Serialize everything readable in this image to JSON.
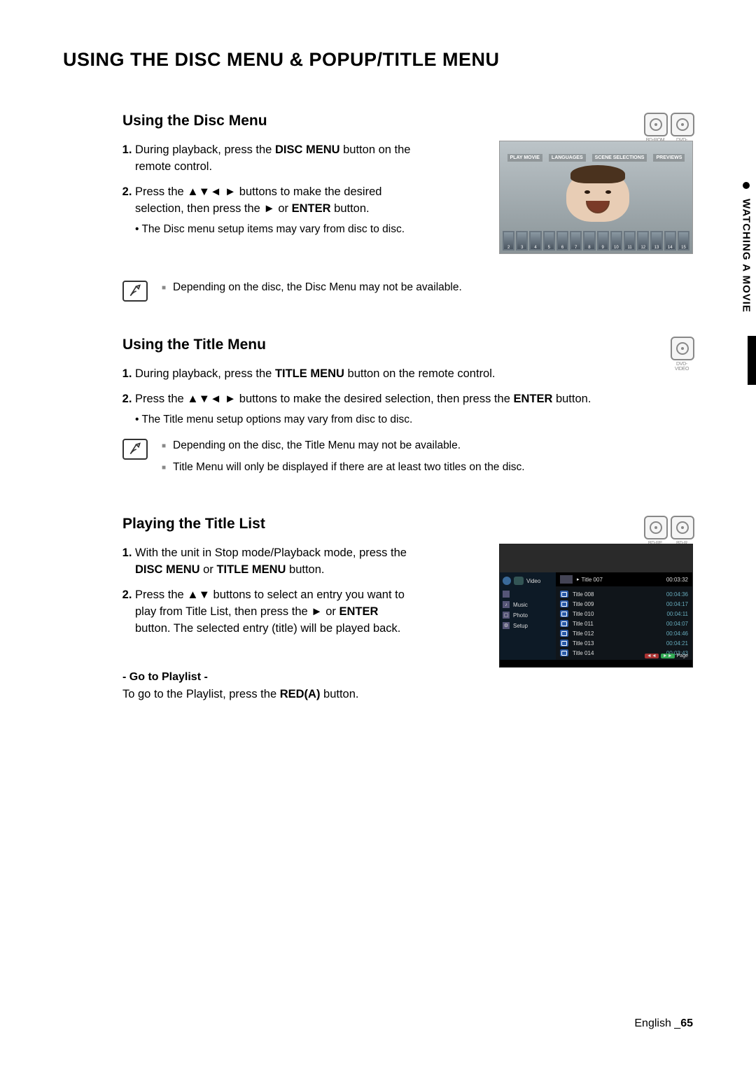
{
  "page_title": "USING THE DISC MENU & POPUP/TITLE MENU",
  "side_tab": "WATCHING A MOVIE",
  "arrows4": "▲▼◄ ►",
  "arrows2": "▲▼",
  "play_sym": "►",
  "disc_labels": {
    "bdrom": "BD-ROM",
    "dvdvideo": "DVD-VIDEO",
    "bdre": "BD-RE",
    "bdr": "BD-R"
  },
  "sections": {
    "disc_menu": {
      "title": "Using the Disc Menu",
      "step1_a": "During playback, press the ",
      "step1_b": "DISC MENU",
      "step1_c": " button on the remote control.",
      "step2_a": "Press the ",
      "step2_b": " buttons to make the desired selection, then press the ",
      "step2_c": " or ",
      "step2_d": "ENTER",
      "step2_e": " button.",
      "sub1": "The Disc menu setup items may vary from disc to disc.",
      "note1": "Depending on the disc, the Disc Menu may not be available.",
      "screenshot_menu": [
        "PLAY MOVIE",
        "LANGUAGES",
        "SCENE SELECTIONS",
        "PREVIEWS"
      ],
      "thumbs": [
        "2",
        "3",
        "4",
        "5",
        "6",
        "7",
        "8",
        "9",
        "10",
        "11",
        "12",
        "13",
        "14",
        "15"
      ]
    },
    "title_menu": {
      "title": "Using the Title Menu",
      "step1_a": "During playback, press the ",
      "step1_b": "TITLE MENU",
      "step1_c": " button on the remote control.",
      "step2_a": "Press the ",
      "step2_b": " buttons to make the desired selection, then press the ",
      "step2_c": "ENTER",
      "step2_d": " button.",
      "sub1": "The Title menu setup options may vary from disc to disc.",
      "note1": "Depending on the disc, the Title Menu may not be available.",
      "note2": "Title Menu will only be displayed if there are at least two titles on the disc."
    },
    "title_list": {
      "title": "Playing the Title List",
      "step1_a": "With the unit in Stop mode/Playback mode, press the ",
      "step1_b": "DISC MENU",
      "step1_c": " or ",
      "step1_d": "TITLE MENU",
      "step1_e": " button.",
      "step2_a": "Press the ",
      "step2_b": " buttons to select an entry you want to play from Title List, then press the ",
      "step2_c": " or ",
      "step2_d": "ENTER",
      "step2_e": " button. The selected entry (title) will be played back.",
      "sub_heading": "- Go to Playlist -",
      "sub_text_a": "To go to the Playlist, press the ",
      "sub_text_b": "RED(A)",
      "sub_text_c": " button.",
      "sidebar": {
        "video": "Video",
        "music": "Music",
        "photo": "Photo",
        "setup": "Setup"
      },
      "selected": {
        "name": "Title 007",
        "time": "00:03:32"
      },
      "rows": [
        {
          "name": "Title 008",
          "time": "00:04:36"
        },
        {
          "name": "Title 009",
          "time": "00:04:17"
        },
        {
          "name": "Title 010",
          "time": "00:04:11"
        },
        {
          "name": "Title 011",
          "time": "00:04:07"
        },
        {
          "name": "Title 012",
          "time": "00:04:46"
        },
        {
          "name": "Title 013",
          "time": "00:04:21"
        },
        {
          "name": "Title 014",
          "time": "00:03:43"
        }
      ],
      "page_hint": "Page"
    }
  },
  "footer": {
    "lang": "English ",
    "sep": "_",
    "num": "65"
  }
}
